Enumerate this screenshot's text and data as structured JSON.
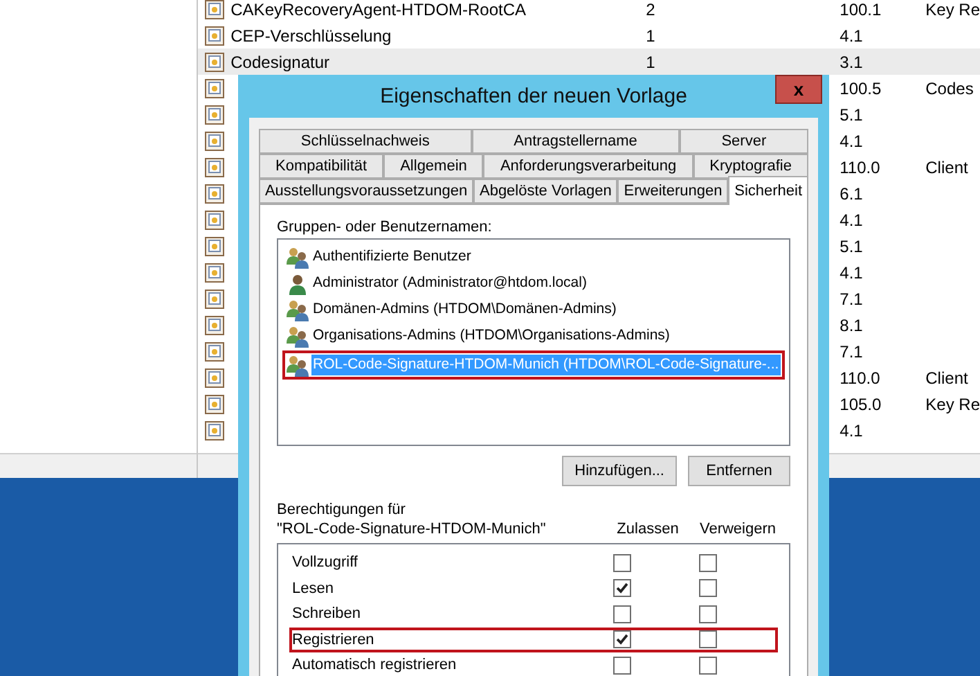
{
  "templates": {
    "rows": [
      {
        "name": "CAKeyRecoveryAgent-HTDOM-RootCA",
        "count": "2",
        "version": "100.1",
        "purpose": "Key Re",
        "selected": false
      },
      {
        "name": "CEP-Verschlüsselung",
        "count": "1",
        "version": "4.1",
        "selected": false
      },
      {
        "name": "Codesignatur",
        "count": "1",
        "version": "3.1",
        "selected": true
      },
      {
        "version": "100.5",
        "purpose": "Codes",
        "selected": false
      },
      {
        "version": "5.1",
        "selected": false
      },
      {
        "version": "4.1",
        "selected": false
      },
      {
        "version": "110.0",
        "purpose": "Client",
        "selected": false
      },
      {
        "version": "6.1",
        "selected": false
      },
      {
        "version": "4.1",
        "selected": false
      },
      {
        "version": "5.1",
        "selected": false
      },
      {
        "version": "4.1",
        "selected": false
      },
      {
        "version": "7.1",
        "selected": false
      },
      {
        "version": "8.1",
        "selected": false
      },
      {
        "version": "7.1",
        "selected": false
      },
      {
        "version": "110.0",
        "purpose": "Client",
        "selected": false
      },
      {
        "version": "105.0",
        "purpose": "Key Re",
        "selected": false
      },
      {
        "version": "4.1",
        "selected": false
      }
    ]
  },
  "dialog": {
    "title": "Eigenschaften der neuen Vorlage",
    "close": "x",
    "tab_rows": [
      [
        {
          "label": "Schlüsselnachweis",
          "selected": false
        },
        {
          "label": "Antragstellername",
          "selected": false
        },
        {
          "label": "Server",
          "selected": false
        }
      ],
      [
        {
          "label": "Kompatibilität",
          "selected": false
        },
        {
          "label": "Allgemein",
          "selected": false
        },
        {
          "label": "Anforderungsverarbeitung",
          "selected": false
        },
        {
          "label": "Kryptografie",
          "selected": false
        }
      ],
      [
        {
          "label": "Ausstellungsvoraussetzungen",
          "selected": false
        },
        {
          "label": "Abgelöste Vorlagen",
          "selected": false
        },
        {
          "label": "Erweiterungen",
          "selected": false
        },
        {
          "label": "Sicherheit",
          "selected": true
        }
      ]
    ],
    "principals_label": "Gruppen- oder Benutzernamen:",
    "principals": [
      {
        "kind": "group",
        "name": "Authentifizierte Benutzer",
        "selected": false,
        "highlighted": false
      },
      {
        "kind": "user",
        "name": "Administrator (Administrator@htdom.local)",
        "selected": false,
        "highlighted": false
      },
      {
        "kind": "group",
        "name": "Domänen-Admins (HTDOM\\Domänen-Admins)",
        "selected": false,
        "highlighted": false
      },
      {
        "kind": "group",
        "name": "Organisations-Admins (HTDOM\\Organisations-Admins)",
        "selected": false,
        "highlighted": false
      },
      {
        "kind": "group",
        "name": "ROL-Code-Signature-HTDOM-Munich (HTDOM\\ROL-Code-Signature-...",
        "selected": true,
        "highlighted": true
      }
    ],
    "buttons": [
      "Hinzufügen...",
      "Entfernen"
    ],
    "permissions": {
      "label_line_1": "Berechtigungen für",
      "label_line_2": "\"ROL-Code-Signature-HTDOM-Munich\"",
      "allow_header": "Zulassen",
      "deny_header": "Verweigern",
      "rows": [
        {
          "name": "Vollzugriff",
          "allow": false,
          "deny": false,
          "highlighted": false
        },
        {
          "name": "Lesen",
          "allow": true,
          "deny": false,
          "highlighted": false
        },
        {
          "name": "Schreiben",
          "allow": false,
          "deny": false,
          "highlighted": false
        },
        {
          "name": "Registrieren",
          "allow": true,
          "deny": false,
          "highlighted": true
        },
        {
          "name": "Automatisch registrieren",
          "allow": false,
          "deny": false,
          "highlighted": false
        }
      ]
    }
  }
}
